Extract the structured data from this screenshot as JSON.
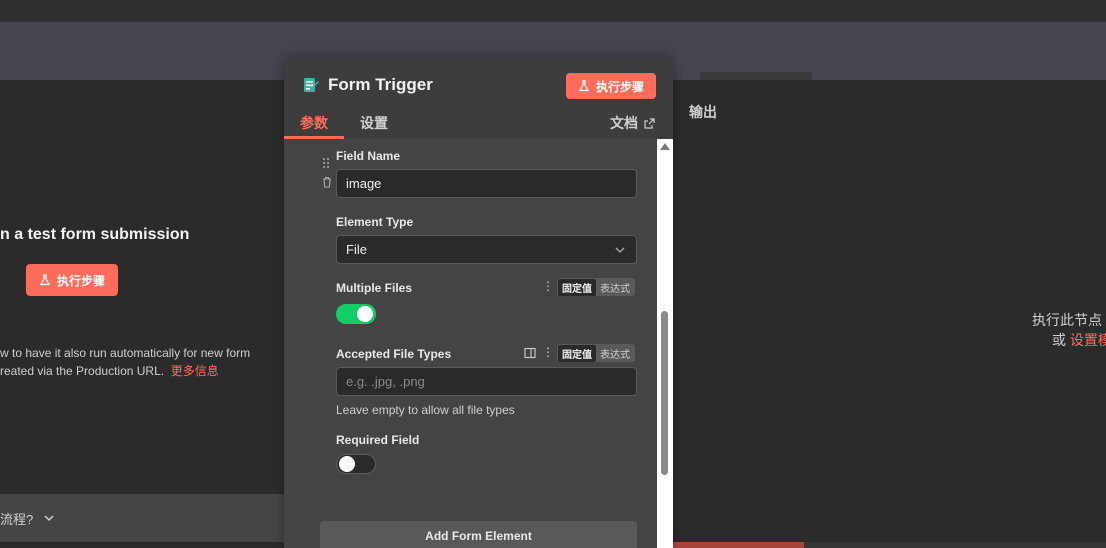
{
  "left_panel": {
    "title": "n a test form submission",
    "exec_label": "执行步骤",
    "desc_line1": "w to have it also run automatically for new form",
    "desc_line2": "reated via the Production URL.",
    "more_link": "更多信息",
    "footer_text": "流程?"
  },
  "modal": {
    "title": "Form Trigger",
    "exec_label": "执行步骤",
    "tabs": {
      "params": "参数",
      "settings": "设置"
    },
    "docs_label": "文档",
    "fields": {
      "field_name_label": "Field Name",
      "field_name_value": "image",
      "element_type_label": "Element Type",
      "element_type_value": "File",
      "multiple_files_label": "Multiple Files",
      "multiple_files_on": true,
      "accepted_types_label": "Accepted File Types",
      "accepted_types_placeholder": "e.g. .jpg, .png",
      "accepted_types_hint": "Leave empty to allow all file types",
      "required_label": "Required Field",
      "required_on": false
    },
    "seg_fixed": "固定值",
    "seg_expr": "表达式",
    "add_element_label": "Add Form Element"
  },
  "right_panel": {
    "output_title": "输出",
    "msg_line1": "执行此节点",
    "msg_line2_prefix": "或",
    "msg_line2_link": "设置模"
  },
  "colors": {
    "accent": "#ff6d5a",
    "toggle_on": "#13ce66"
  }
}
